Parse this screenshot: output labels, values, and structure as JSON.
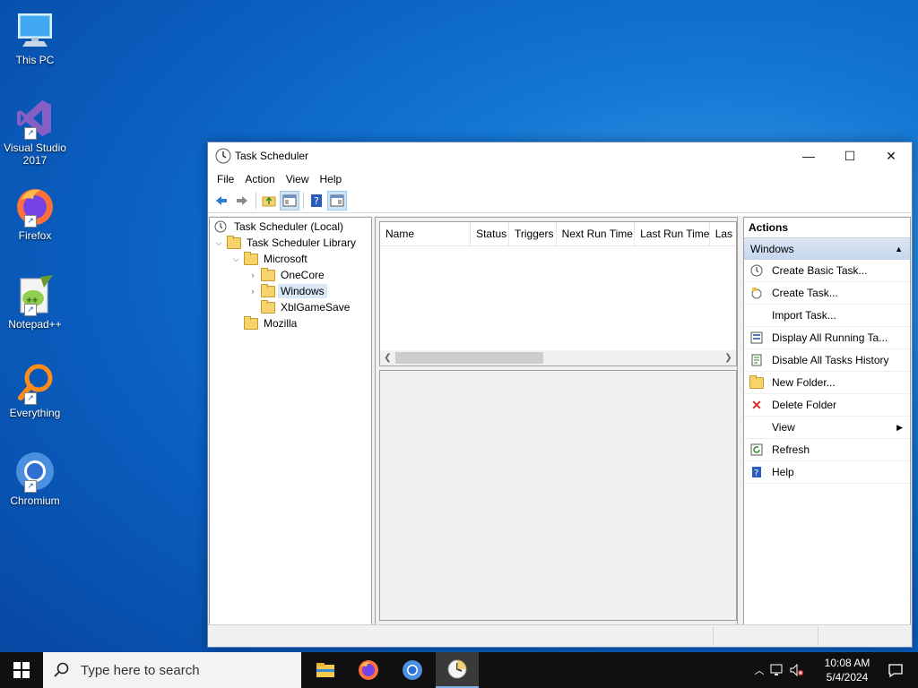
{
  "desktop": {
    "icons": [
      {
        "label_l1": "This PC",
        "label_l2": ""
      },
      {
        "label_l1": "Visual Studio",
        "label_l2": "2017"
      },
      {
        "label_l1": "Firefox",
        "label_l2": ""
      },
      {
        "label_l1": "Notepad++",
        "label_l2": ""
      },
      {
        "label_l1": "Everything",
        "label_l2": ""
      },
      {
        "label_l1": "Chromium",
        "label_l2": ""
      }
    ]
  },
  "window": {
    "title": "Task Scheduler",
    "icon": "clock-icon",
    "controls": {
      "minimize": "—",
      "maximize": "☐",
      "close": "✕"
    }
  },
  "menubar": [
    "File",
    "Action",
    "View",
    "Help"
  ],
  "toolbar": {
    "icons": [
      "back-arrow-icon",
      "forward-arrow-icon",
      "up-folder-icon",
      "show-hide-console-tree-icon",
      "help-icon",
      "show-hide-action-pane-icon"
    ]
  },
  "tree": {
    "root": "Task Scheduler (Local)",
    "library": "Task Scheduler Library",
    "microsoft": "Microsoft",
    "onecore": "OneCore",
    "windows": "Windows",
    "xbl": "XblGameSave",
    "mozilla": "Mozilla",
    "selected": "Windows"
  },
  "list": {
    "columns": [
      "Name",
      "Status",
      "Triggers",
      "Next Run Time",
      "Last Run Time",
      "Las"
    ]
  },
  "actions": {
    "title": "Actions",
    "group": "Windows",
    "items": [
      {
        "label": "Create Basic Task...",
        "icon": "create-basic-task-icon"
      },
      {
        "label": "Create Task...",
        "icon": "create-task-icon"
      },
      {
        "label": "Import Task...",
        "icon": ""
      },
      {
        "label": "Display All Running Ta...",
        "icon": "display-running-icon"
      },
      {
        "label": "Disable All Tasks History",
        "icon": "disable-history-icon"
      },
      {
        "label": "New Folder...",
        "icon": "new-folder-icon"
      },
      {
        "label": "Delete Folder",
        "icon": "delete-icon"
      },
      {
        "label": "View",
        "icon": "",
        "submenu": true
      },
      {
        "label": "Refresh",
        "icon": "refresh-icon"
      },
      {
        "label": "Help",
        "icon": "help-icon"
      }
    ]
  },
  "taskbar": {
    "search_placeholder": "Type here to search",
    "apps": [
      "file-explorer-icon",
      "firefox-icon",
      "chromium-icon",
      "task-scheduler-icon"
    ],
    "time": "10:08 AM",
    "date": "5/4/2024"
  },
  "colors": {
    "accent": "#0078d7",
    "selection": "#d9e8f7",
    "actions_group": "#c5d6ec"
  }
}
